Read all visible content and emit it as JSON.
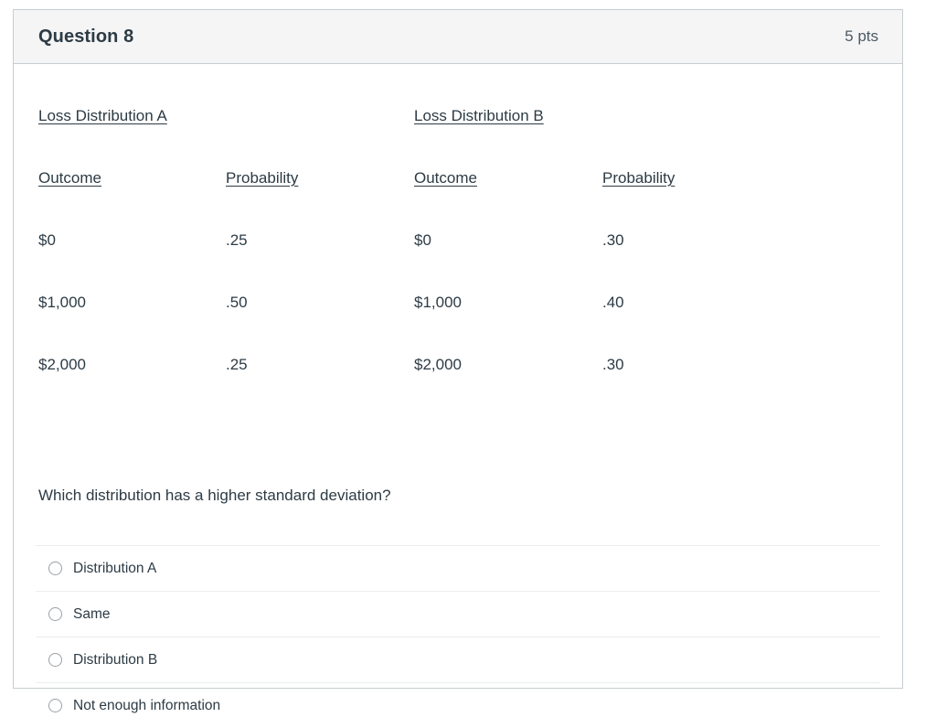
{
  "header": {
    "title": "Question 8",
    "points": "5 pts"
  },
  "distributions": [
    {
      "name": "Loss Distribution A",
      "columns": [
        "Outcome",
        "Probability"
      ],
      "rows": [
        [
          "$0",
          ".25"
        ],
        [
          "$1,000",
          ".50"
        ],
        [
          "$2,000",
          ".25"
        ]
      ]
    },
    {
      "name": "Loss Distribution B",
      "columns": [
        "Outcome",
        "Probability"
      ],
      "rows": [
        [
          "$0",
          ".30"
        ],
        [
          "$1,000",
          ".40"
        ],
        [
          "$2,000",
          ".30"
        ]
      ]
    }
  ],
  "prompt": "Which distribution has a higher standard deviation?",
  "answers": [
    {
      "label": "Distribution A",
      "selected": false
    },
    {
      "label": "Same",
      "selected": false
    },
    {
      "label": "Distribution B",
      "selected": false
    },
    {
      "label": "Not enough information",
      "selected": false
    }
  ],
  "colors": {
    "text": "#2d3b45",
    "border": "#c7cdd1",
    "header_bg": "#f5f5f5",
    "divider": "#eaecee"
  }
}
